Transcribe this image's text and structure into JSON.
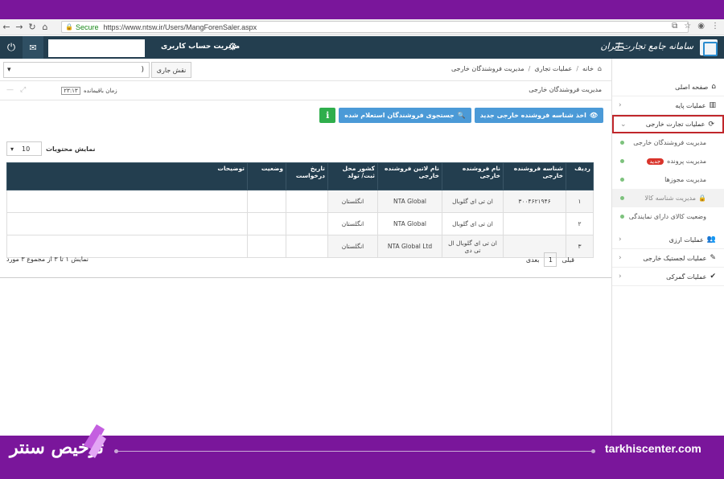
{
  "browser": {
    "secure_label": "Secure",
    "url": "https://www.ntsw.ir/Users/MangForenSaler.aspx"
  },
  "header": {
    "account_label": "مدیریت حساب کاربری",
    "logo_text": "سامانه جامع تجارت ایران"
  },
  "rolebar": {
    "role_value": ")",
    "role_label": "نقش جاری",
    "breadcrumb": [
      "خانه",
      "عملیات تجاری",
      "مدیریت فروشندگان خارجی"
    ]
  },
  "titlebar": {
    "page_title": "مدیریت فروشندگان خارجی",
    "timer_value": "۲۳:۱۳",
    "timer_label": "زمان باقیمانده"
  },
  "actions": {
    "new_id_button": "اخذ شناسه فروشنده خارجی جدید",
    "search_button": "جستجوی فروشندگان استعلام شده"
  },
  "table_controls": {
    "length_label": "نمایش محتویات",
    "length_value": "10"
  },
  "table": {
    "headers": [
      "ردیف",
      "شناسه فروشنده خارجی",
      "نام فروشنده خارجی",
      "نام لاتین فروشنده خارجی",
      "کشور محل ثبت/ تولد",
      "تاریخ درخواست",
      "وضعیت",
      "توضیحات"
    ],
    "rows": [
      {
        "n": "۱",
        "id": "۳۰۰۴۶۲۱۹۴۶",
        "name": "ان تی ای گلوبال",
        "latin": "NTA Global",
        "country": "انگلستان"
      },
      {
        "n": "۲",
        "id": "",
        "name": "ان تی ای گلوبال",
        "latin": "NTA Global",
        "country": "انگلستان"
      },
      {
        "n": "۳",
        "id": "",
        "name": "ان تی ای گلوبال ال تی دی",
        "latin": "NTA Global Ltd",
        "country": "انگلستان"
      }
    ]
  },
  "pager": {
    "prev": "قبلی",
    "page": "1",
    "next": "بعدی",
    "info": "نمایش ۱ تا ۳ از مجموع ۳ مورد"
  },
  "sidebar": {
    "home": "صفحه اصلی",
    "base_ops": "عملیات پایه",
    "foreign_trade": "عملیات تجارت خارجی",
    "sub_sellers": "مدیریت فروشندگان خارجی",
    "sub_files": "مدیریت پرونده",
    "sub_files_badge": "جدید",
    "sub_permits": "مدیریت مجوزها",
    "sub_goods_id": "مدیریت شناسه کالا",
    "sub_agency": "وضعیت کالای دارای نمایندگی",
    "currency_ops": "عملیات ارزی",
    "logistics_ops": "عملیات لجستیک خارجی",
    "customs_ops": "عملیات گمرکی"
  },
  "footer": {
    "site": "tarkhiscenter.com",
    "brand": "ترخیص سنتر"
  },
  "colors": {
    "header_bg": "#233e4f",
    "frame_purple": "#7a169b",
    "button_blue": "#4b9ad7",
    "button_green": "#2fae4c",
    "active_border": "#c0262b"
  }
}
